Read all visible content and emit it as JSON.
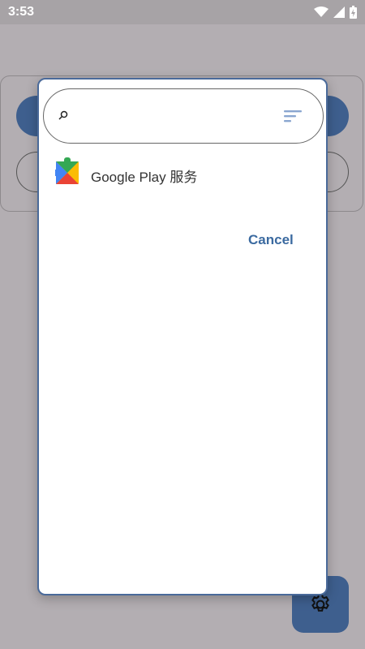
{
  "status_bar": {
    "time": "3:53"
  },
  "dialog": {
    "search": {
      "placeholder": "",
      "value": ""
    },
    "apps": [
      {
        "label": "Google Play 服务",
        "icon": "google-play-services-icon"
      }
    ],
    "cancel_label": "Cancel"
  },
  "colors": {
    "accent": "#3e5f8e",
    "cancel": "#3b6aa0",
    "scrim": "#b3aeb2"
  }
}
